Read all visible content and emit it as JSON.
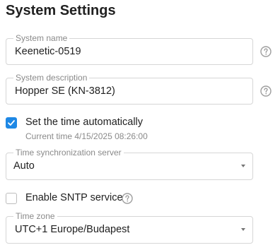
{
  "page": {
    "title": "System Settings"
  },
  "system_name": {
    "label": "System name",
    "value": "Keenetic-0519"
  },
  "system_description": {
    "label": "System description",
    "value": "Hopper SE (KN-3812)"
  },
  "auto_time": {
    "label": "Set the time automatically",
    "checked": true,
    "current_time": "Current time 4/15/2025 08:26:00"
  },
  "time_server": {
    "label": "Time synchronization server",
    "value": "Auto"
  },
  "sntp": {
    "label": "Enable SNTP service",
    "checked": false
  },
  "time_zone": {
    "label": "Time zone",
    "value": "UTC+1 Europe/Budapest"
  },
  "icons": {
    "help": "help-circle-icon",
    "check": "check-icon",
    "dropdown": "chevron-down-icon"
  },
  "colors": {
    "accent": "#1e88e5",
    "border": "#d6d6d6",
    "label": "#8a8a8a",
    "text": "#212121",
    "icon": "#9e9e9e"
  }
}
